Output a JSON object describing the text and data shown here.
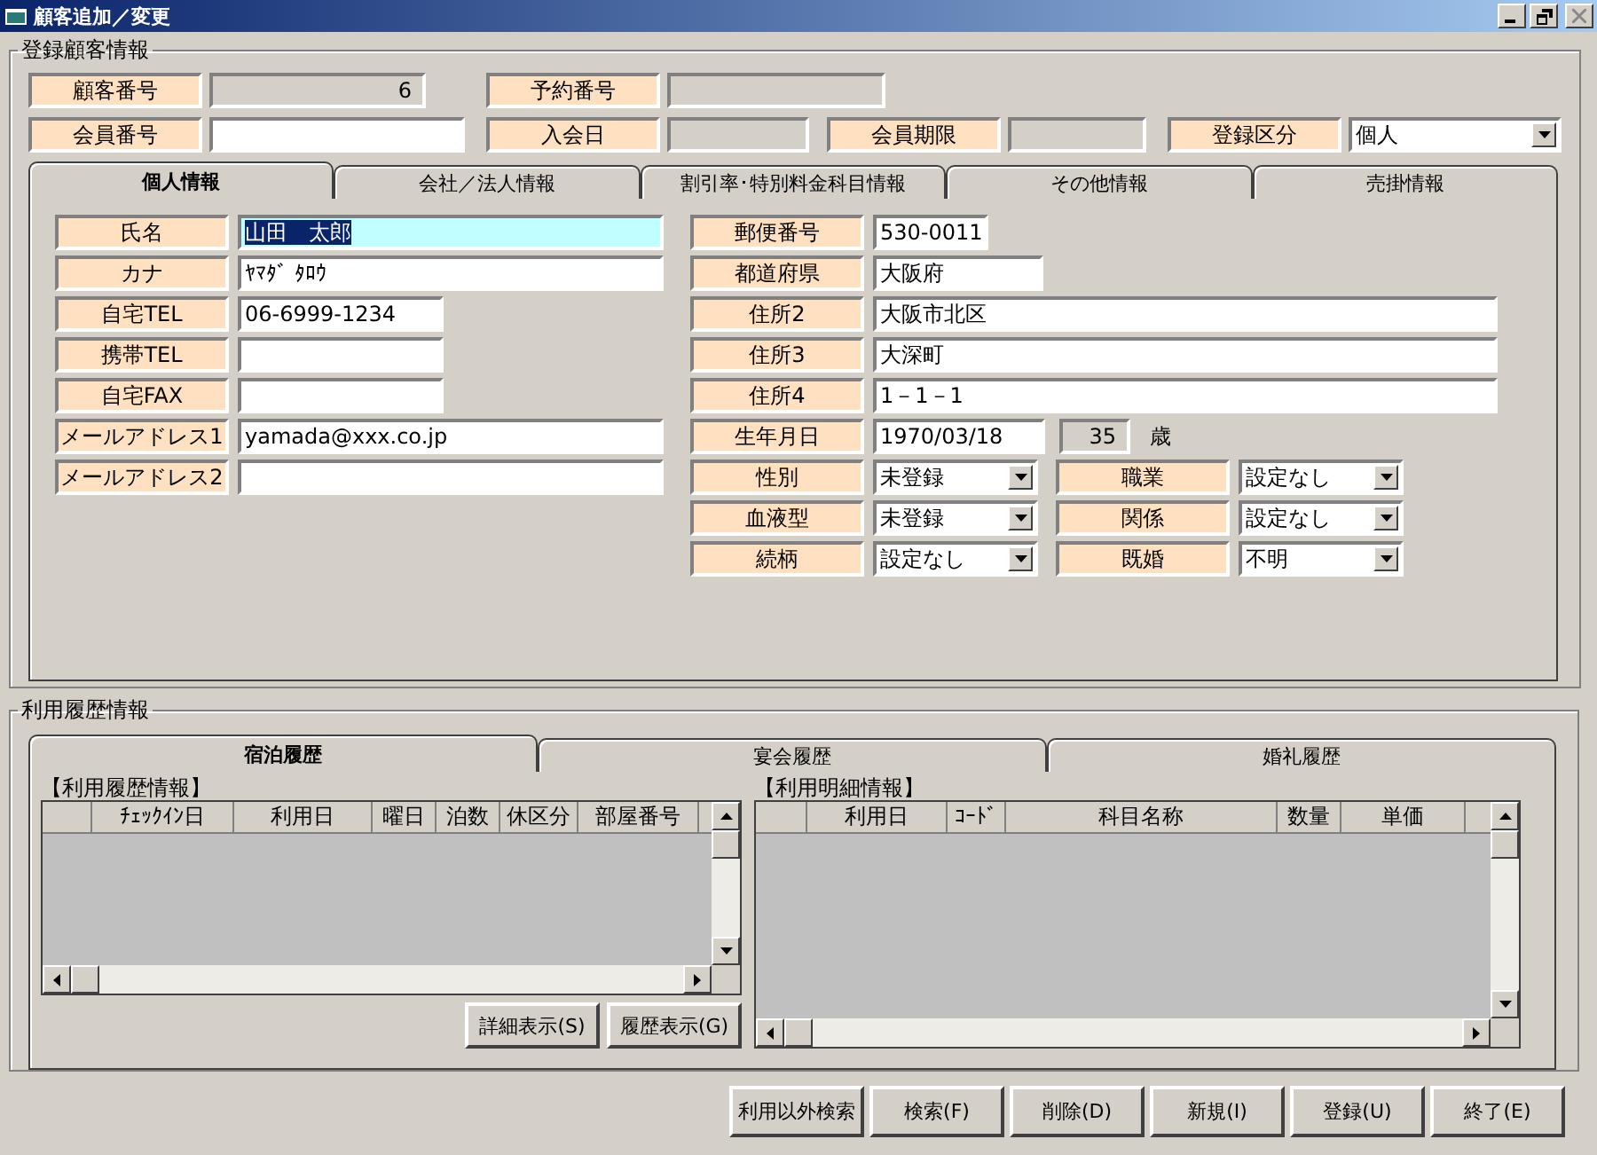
{
  "window": {
    "title": "顧客追加／変更"
  },
  "customer_group": {
    "title": "登録顧客情報",
    "header_rows": [
      [
        {
          "label": "顧客番号",
          "value": "6",
          "kind": "readonly"
        },
        {
          "label": "予約番号",
          "kind": "readonly"
        }
      ],
      [
        {
          "label": "会員番号",
          "kind": "text"
        },
        {
          "label": "入会日",
          "kind": "readonly"
        },
        {
          "label": "会員期限",
          "kind": "readonly"
        },
        {
          "label": "登録区分",
          "value": "個人",
          "kind": "select"
        }
      ]
    ],
    "tabs": [
      {
        "label": "個人情報",
        "selected": true
      },
      {
        "label": "会社／法人情報",
        "selected": false
      },
      {
        "label": "割引率･特別料金科目情報",
        "selected": false
      },
      {
        "label": "その他情報",
        "selected": false
      },
      {
        "label": "売掛情報",
        "selected": false
      }
    ],
    "left_fields": [
      {
        "label": "氏名",
        "value": "山田　太郎",
        "focused": true
      },
      {
        "label": "カナ",
        "value": "ﾔﾏﾀﾞ ﾀﾛｳ",
        "focused": false
      },
      {
        "label": "自宅TEL",
        "value": "06-6999-1234",
        "focused": false
      },
      {
        "label": "携帯TEL",
        "focused": false
      },
      {
        "label": "自宅FAX",
        "focused": false
      },
      {
        "label": "メールアドレス1",
        "value": "yamada@xxx.co.jp",
        "focused": false
      },
      {
        "label": "メールアドレス2",
        "focused": false
      }
    ],
    "right_fields": [
      {
        "label": "郵便番号",
        "value": "530-0011",
        "kind": "text"
      },
      {
        "label": "都道府県",
        "value": "大阪府",
        "kind": "text"
      },
      {
        "label": "住所2",
        "value": "大阪市北区",
        "kind": "text"
      },
      {
        "label": "住所3",
        "value": "大深町",
        "kind": "text"
      },
      {
        "label": "住所4",
        "value": "1－1－1",
        "kind": "text"
      },
      {
        "label": "生年月日",
        "value": "1970/03/18",
        "kind": "birthdate",
        "age": "35",
        "age_unit": "歳"
      }
    ],
    "select_rows": [
      [
        {
          "label": "性別",
          "value": "未登録"
        },
        {
          "label": "職業",
          "value": "設定なし"
        }
      ],
      [
        {
          "label": "血液型",
          "value": "未登録"
        },
        {
          "label": "関係",
          "value": "設定なし"
        }
      ],
      [
        {
          "label": "続柄",
          "value": "設定なし"
        },
        {
          "label": "既婚",
          "value": "不明"
        }
      ]
    ]
  },
  "history_group": {
    "title": "利用履歴情報",
    "tabs": [
      {
        "label": "宿泊履歴",
        "selected": true
      },
      {
        "label": "宴会履歴",
        "selected": false
      },
      {
        "label": "婚礼履歴",
        "selected": false
      }
    ],
    "stay_grid": {
      "title": "【利用履歴情報】",
      "columns": [
        "ﾁｪｯｸｲﾝ日",
        "利用日",
        "曜日",
        "泊数",
        "休区分",
        "部屋番号"
      ]
    },
    "grid_buttons": [
      "詳細表示(S)",
      "履歴表示(G)"
    ],
    "detail_grid": {
      "title": "【利用明細情報】",
      "columns": [
        "利用日",
        "ｺｰﾄﾞ",
        "科目名称",
        "数量",
        "単価"
      ]
    }
  },
  "buttons": [
    "利用以外検索",
    "検索(F)",
    "削除(D)",
    "新規(I)",
    "登録(U)",
    "終了(E)"
  ]
}
